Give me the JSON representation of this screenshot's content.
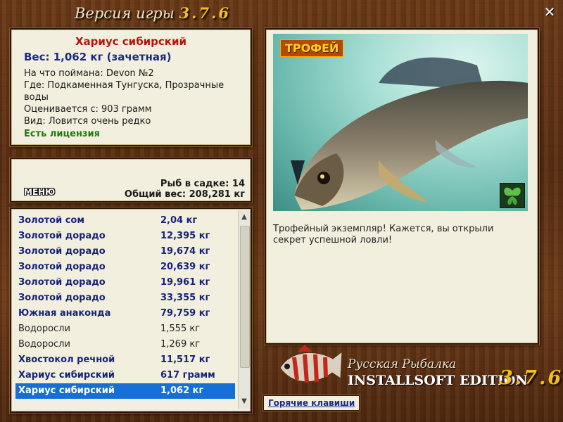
{
  "window": {
    "title_prefix": "Версия игры",
    "title_version": "3.7.6",
    "close_glyph": "✕"
  },
  "catch_info": {
    "fish_name": "Хариус сибирский",
    "weight": "Вес: 1,062 кг (зачетная)",
    "bait": "На что поймана: Devon №2",
    "place": "Где: Подкаменная Тунгуска, Прозрачные воды",
    "value": "Оценивается с: 903 грамм",
    "kind": "Вид: Ловится очень редко",
    "license": "Есть лицензия"
  },
  "stats": {
    "menu_label": "МЕНЮ",
    "fish_count": "Рыб в садке: 14",
    "total_weight": "Общий вес: 208,281 кг"
  },
  "catch_list": [
    {
      "name": "Золотой сом",
      "weight": "2,04 кг",
      "style": "bold"
    },
    {
      "name": "Золотой дорадо",
      "weight": "12,395 кг",
      "style": "bold"
    },
    {
      "name": "Золотой дорадо",
      "weight": "19,674 кг",
      "style": "bold"
    },
    {
      "name": "Золотой дорадо",
      "weight": "20,639 кг",
      "style": "bold"
    },
    {
      "name": "Золотой дорадо",
      "weight": "19,961 кг",
      "style": "bold"
    },
    {
      "name": "Золотой дорадо",
      "weight": "33,355 кг",
      "style": "bold"
    },
    {
      "name": "Южная анаконда",
      "weight": "79,759 кг",
      "style": "bold"
    },
    {
      "name": "Водоросли",
      "weight": "1,555 кг",
      "style": "plain"
    },
    {
      "name": "Водоросли",
      "weight": "1,269 кг",
      "style": "plain"
    },
    {
      "name": "Хвостокол речной",
      "weight": "11,517 кг",
      "style": "bold"
    },
    {
      "name": "Хариус сибирский",
      "weight": "617 грамм",
      "style": "bold"
    },
    {
      "name": "Хариус сибирский",
      "weight": "1,062 кг",
      "style": "selected"
    }
  ],
  "trophy": {
    "badge": "ТРОФЕЙ",
    "text": "Трофейный экземпляр! Кажется, вы открыли секрет успешной ловли!"
  },
  "hotkeys_label": "Горячие клавиши",
  "branding": {
    "line1": "Русская Рыбалка",
    "line2": "INSTALLSOFT EDITION",
    "version": "3.7.6"
  },
  "colors": {
    "selection": "#1470d8",
    "fish_name": "#b5140c",
    "weight": "#1c2a88",
    "license": "#1f7a10",
    "version": "#f0c020"
  }
}
